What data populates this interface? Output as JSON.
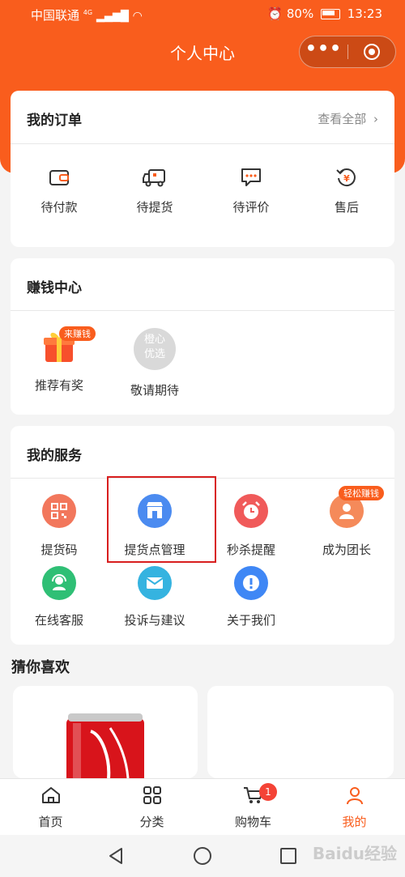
{
  "status_bar": {
    "carrier": "中国联通",
    "network": "4G",
    "battery": "80%",
    "time": "13:23"
  },
  "header": {
    "title": "个人中心"
  },
  "orders": {
    "title": "我的订单",
    "view_all": "查看全部",
    "items": [
      {
        "label": "待付款",
        "icon": "wallet-icon"
      },
      {
        "label": "待提货",
        "icon": "truck-icon"
      },
      {
        "label": "待评价",
        "icon": "chat-icon"
      },
      {
        "label": "售后",
        "icon": "refund-icon"
      }
    ]
  },
  "earn": {
    "title": "赚钱中心",
    "items": [
      {
        "label": "推荐有奖",
        "tag": "来赚钱",
        "icon": "gift-icon"
      },
      {
        "label": "敬请期待",
        "icon_text": "橙心优选",
        "icon": "logo-placeholder-icon"
      }
    ]
  },
  "services": {
    "title": "我的服务",
    "items": [
      {
        "label": "提货码",
        "icon": "qrcode-icon",
        "color": "#f2775c"
      },
      {
        "label": "提货点管理",
        "icon": "store-icon",
        "color": "#4b8bf0"
      },
      {
        "label": "秒杀提醒",
        "icon": "alarm-icon",
        "color": "#f05a5a"
      },
      {
        "label": "成为团长",
        "tag": "轻松赚钱",
        "icon": "group-icon",
        "color": "#f58a5a"
      },
      {
        "label": "在线客服",
        "icon": "headset-icon",
        "color": "#2fbf75"
      },
      {
        "label": "投诉与建议",
        "icon": "mail-icon",
        "color": "#35b3e0"
      },
      {
        "label": "关于我们",
        "icon": "info-icon",
        "color": "#3f87f5"
      }
    ]
  },
  "guess": {
    "title": "猜你喜欢"
  },
  "tabbar": {
    "items": [
      {
        "label": "首页",
        "icon": "home-icon"
      },
      {
        "label": "分类",
        "icon": "grid-icon"
      },
      {
        "label": "购物车",
        "icon": "cart-icon",
        "badge": "1"
      },
      {
        "label": "我的",
        "icon": "user-icon"
      }
    ]
  },
  "watermark": "Baidu经验",
  "colors": {
    "brand": "#f95d1d",
    "highlight_box": "#d81e1e"
  }
}
